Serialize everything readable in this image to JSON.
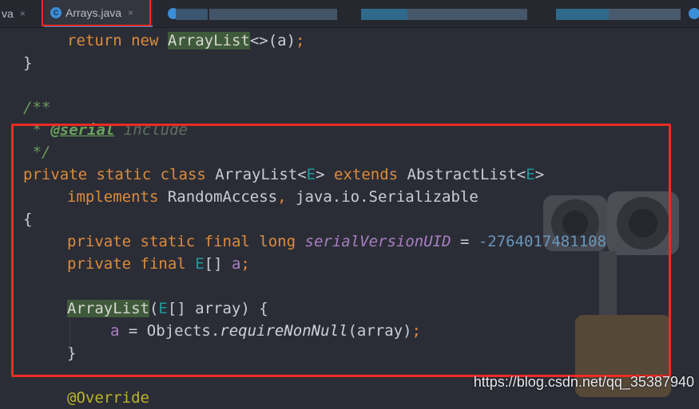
{
  "tabs": {
    "previous": {
      "label": "va",
      "close": "×"
    },
    "active": {
      "label": "Arrays.java",
      "close": "×",
      "icon": "java-class-icon"
    }
  },
  "code": {
    "l1": {
      "kw1": "return",
      "kw2": "new",
      "cls": "ArrayList",
      "rest": "<>(a)",
      "semi": ";"
    },
    "l2": {
      "text": "}"
    },
    "l4": {
      "text": "/**"
    },
    "l5": {
      "star": " * ",
      "tag": "@serial",
      "rest": " include"
    },
    "l6": {
      "text": " */"
    },
    "l7": {
      "kw1": "private",
      "kw2": "static",
      "kw3": "class",
      "name": "ArrayList<",
      "tp1": "E",
      "gt1": "> ",
      "kw4": "extends",
      "base": " AbstractList<",
      "tp2": "E",
      "gt2": ">"
    },
    "l8": {
      "kw": "implements",
      "a": " RandomAccess",
      "comma": ",",
      "b": " java.io.Serializable"
    },
    "l9": {
      "text": "{"
    },
    "l10": {
      "kw1": "private",
      "kw2": "static",
      "kw3": "final",
      "kw4": "long",
      "field": "serialVersionUID",
      "eq": " = ",
      "num": "-2764017481108"
    },
    "l11": {
      "kw1": "private",
      "kw2": "final",
      "tp": "E",
      "arr": "[] ",
      "field": "a",
      "semi": ";"
    },
    "l13": {
      "ctor": "ArrayList",
      "open": "(",
      "tp": "E",
      "rest": "[] array) {"
    },
    "l14": {
      "field": "a",
      "mid": " = Objects.",
      "method": "requireNonNull",
      "rest": "(array)",
      "semi": ";"
    },
    "l15": {
      "text": "}"
    },
    "l17": {
      "ann": "@Override"
    }
  },
  "watermark": "https://blog.csdn.net/qq_35387940",
  "colors": {
    "highlight_box": "#ef2a24",
    "keyword": "#dc8c3c",
    "comment": "#6a9a5a",
    "field": "#a77fc2"
  }
}
